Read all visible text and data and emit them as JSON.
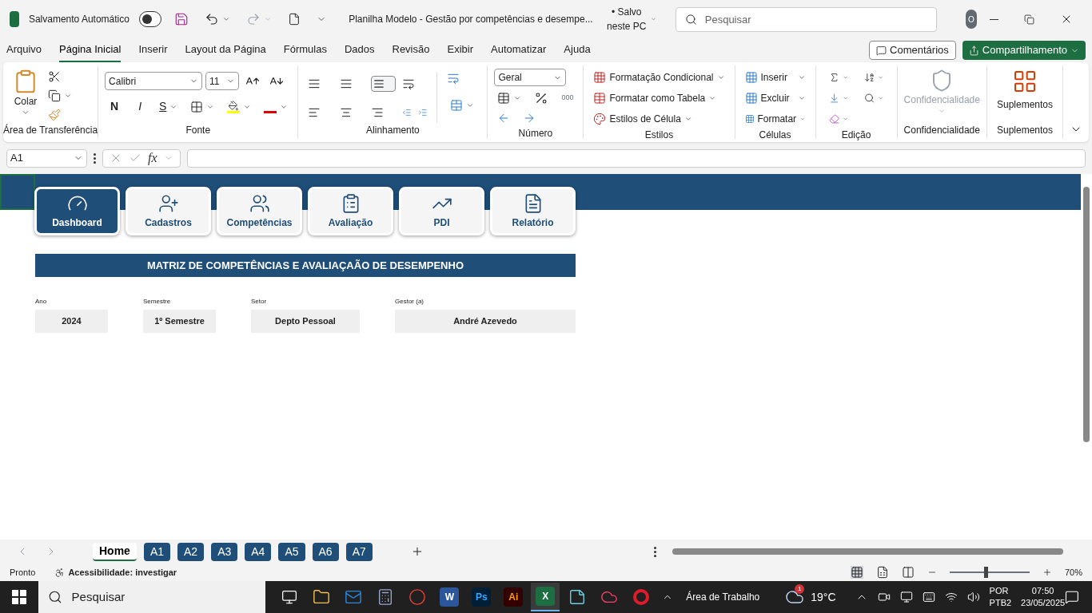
{
  "titlebar": {
    "autosave_label": "Salvamento Automático",
    "autosave_on": false,
    "title": "Planilha Modelo - Gestão por competências e desempe...",
    "saved_status": "• Salvo neste PC",
    "search_placeholder": "Pesquisar",
    "avatar": "O"
  },
  "menu": [
    {
      "label": "Arquivo",
      "selected": false
    },
    {
      "label": "Página Inicial",
      "selected": true
    },
    {
      "label": "Inserir",
      "selected": false
    },
    {
      "label": "Layout da Página",
      "selected": false
    },
    {
      "label": "Fórmulas",
      "selected": false
    },
    {
      "label": "Dados",
      "selected": false
    },
    {
      "label": "Revisão",
      "selected": false
    },
    {
      "label": "Exibir",
      "selected": false
    },
    {
      "label": "Automatizar",
      "selected": false
    },
    {
      "label": "Ajuda",
      "selected": false
    }
  ],
  "comments_button": "Comentários",
  "share_button": "Compartilhamento",
  "ribbon": {
    "paste": "Colar",
    "font_name": "Calibri",
    "font_size": "11",
    "bold": "N",
    "italic": "I",
    "underline": "S",
    "number_format": "Geral",
    "thousands": "000",
    "styles": [
      "Formatação Condicional",
      "Formatar como Tabela",
      "Estilos de Célula"
    ],
    "cells": [
      "Inserir",
      "Excluir",
      "Formatar"
    ],
    "confidentiality": "Confidencialidade",
    "addins": "Suplementos",
    "groups": [
      "Área de Transferência",
      "Fonte",
      "Alinhamento",
      "Número",
      "Estilos",
      "Células",
      "Edição",
      "Confidencialidade",
      "Suplementos"
    ]
  },
  "formula_bar": {
    "name_box": "A1",
    "fx": "fx"
  },
  "sheet": {
    "nav": [
      {
        "label": "Dashboard",
        "selected": true,
        "kind": "gauge"
      },
      {
        "label": "Cadastros",
        "selected": false,
        "kind": "user"
      },
      {
        "label": "Competências",
        "selected": false,
        "kind": "team"
      },
      {
        "label": "Avaliação",
        "selected": false,
        "kind": "clipboard"
      },
      {
        "label": "PDI",
        "selected": false,
        "kind": "chart"
      },
      {
        "label": "Relatório",
        "selected": false,
        "kind": "report"
      }
    ],
    "banner": "MATRIZ DE COMPETÊNCIAS E AVALIAÇAÃO DE DESEMPENHO",
    "fields": [
      {
        "label": "Ano",
        "value": "2024"
      },
      {
        "label": "Semestre",
        "value": "1º Semestre"
      },
      {
        "label": "Setor",
        "value": "Depto Pessoal"
      },
      {
        "label": "Gestor (a)",
        "value": "André Azevedo"
      }
    ]
  },
  "sheet_tabs": [
    {
      "label": "Home",
      "selected": true
    },
    {
      "label": "A1",
      "selected": false
    },
    {
      "label": "A2",
      "selected": false
    },
    {
      "label": "A3",
      "selected": false
    },
    {
      "label": "A4",
      "selected": false
    },
    {
      "label": "A5",
      "selected": false
    },
    {
      "label": "A6",
      "selected": false
    },
    {
      "label": "A7",
      "selected": false
    }
  ],
  "status_bar": {
    "ready": "Pronto",
    "accessibility": "Acessibilidade: investigar",
    "zoom": "70%",
    "zoom_level": {
      "level": 0.45
    }
  },
  "taskbar": {
    "search": "Pesquisar",
    "apps": [
      {
        "kind": "folder",
        "active": false
      },
      {
        "kind": "mail",
        "active": false
      },
      {
        "kind": "calc",
        "active": false
      },
      {
        "kind": "browser",
        "active": false
      },
      {
        "kind": "word",
        "label": "W",
        "active": false
      },
      {
        "kind": "ps",
        "label": "Ps",
        "active": false
      },
      {
        "kind": "ai",
        "label": "Ai",
        "active": false
      },
      {
        "kind": "excel",
        "label": "X",
        "active": true
      },
      {
        "kind": "notes",
        "active": false
      },
      {
        "kind": "cloud",
        "active": false
      },
      {
        "kind": "opera",
        "active": false
      }
    ],
    "desktop": "Área de Trabalho",
    "weather_badge": "1",
    "temperature": "19°C",
    "lang": "POR",
    "layout": "PTB2",
    "time": "07:50",
    "date": "23/05/2025"
  }
}
